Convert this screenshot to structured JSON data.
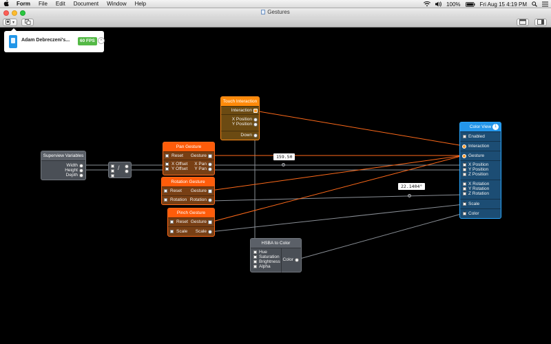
{
  "menubar": {
    "apple": "",
    "items": [
      "Form",
      "File",
      "Edit",
      "Document",
      "Window",
      "Help"
    ],
    "battery": "100%",
    "datetime": "Fri Aug 15  4:19 PM"
  },
  "window": {
    "title": "Gestures"
  },
  "device_popover": {
    "name": "Adam Debreczeni's...",
    "fps": "60 FPS"
  },
  "nodes": {
    "superview": {
      "title": "Superview Variables",
      "outputs": [
        "Width",
        "Height",
        "Depth"
      ]
    },
    "touch": {
      "title": "Touch Interaction",
      "interaction": "Interaction",
      "x": "X Position",
      "y": "Y Position",
      "down": "Down"
    },
    "pan": {
      "title": "Pan Gesture",
      "in": [
        "Reset",
        "X Offset",
        "Y Offset"
      ],
      "out": [
        "Gesture",
        "X Pan",
        "Y Pan"
      ]
    },
    "rotation": {
      "title": "Rotation Gesture",
      "in": [
        "Reset",
        "Rotation"
      ],
      "out": [
        "Gesture",
        "Rotation"
      ]
    },
    "pinch": {
      "title": "Pinch Gesture",
      "in": [
        "Reset",
        "Scale"
      ],
      "out": [
        "Gesture",
        "Scale"
      ]
    },
    "hsba": {
      "title": "HSBA to Color",
      "in": [
        "Hue",
        "Saturation",
        "Brightness",
        "Alpha"
      ],
      "out": "Color"
    },
    "color_view": {
      "title": "Color View",
      "badge": "1",
      "inputs": [
        "Enabled",
        "Interaction",
        "Gesture",
        "X Position",
        "Y Position",
        "Z Position",
        "X Rotation",
        "Y Rotation",
        "Z Rotation",
        "Scale",
        "Color"
      ]
    }
  },
  "value_labels": {
    "pan_value": "159.50",
    "rotation_value": "22.1404°"
  },
  "colors": {
    "orange": "#ff5c0a",
    "amber": "#ff8a0a",
    "blue": "#2496ea",
    "gray_node": "#4a4f56",
    "wire_gray": "#8a8f96"
  }
}
